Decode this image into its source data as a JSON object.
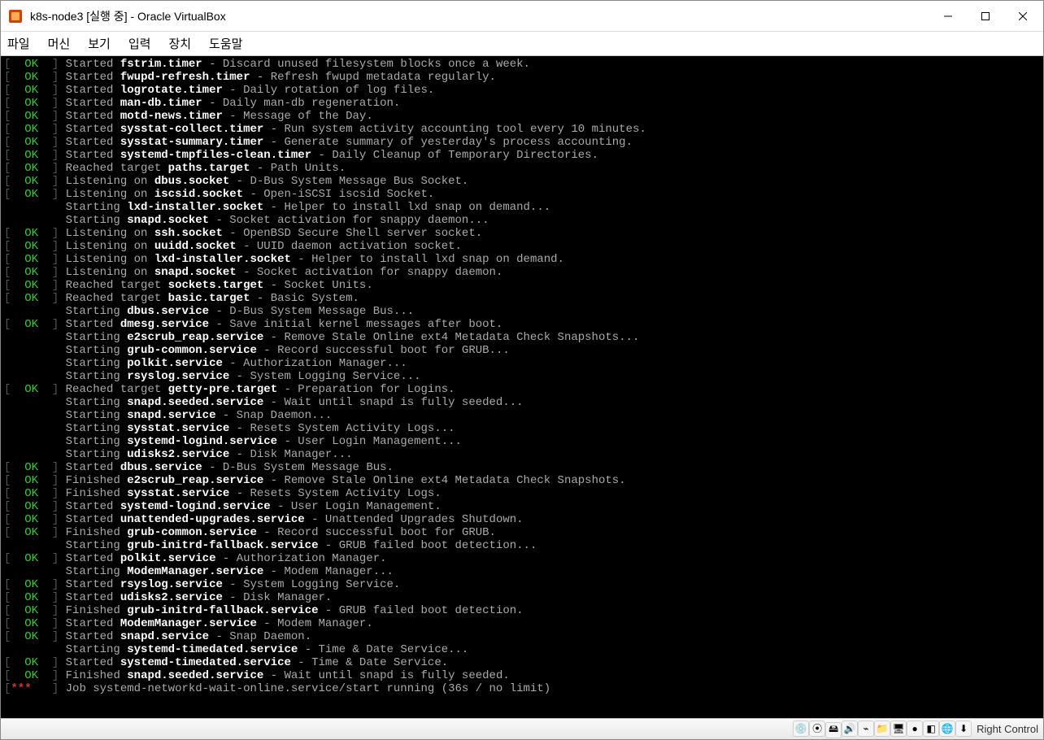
{
  "window": {
    "title": "k8s-node3 [실행 중] - Oracle VirtualBox",
    "key_label": "Right Control"
  },
  "menu": {
    "file": "파일",
    "machine": "머신",
    "view": "보기",
    "input": "입력",
    "device": "장치",
    "help": "도움말"
  },
  "status_icons": [
    "optical-drive-icon",
    "cd-icon",
    "disk-icon",
    "audio-icon",
    "usb-icon",
    "folder-icon",
    "display-icon",
    "record-icon",
    "guest-additions-icon",
    "network-icon",
    "keyboard-capture-icon"
  ],
  "logs": [
    {
      "status": "OK",
      "action": "Started",
      "unit": "fstrim.timer",
      "desc": "Discard unused filesystem blocks once a week."
    },
    {
      "status": "OK",
      "action": "Started",
      "unit": "fwupd-refresh.timer",
      "desc": "Refresh fwupd metadata regularly."
    },
    {
      "status": "OK",
      "action": "Started",
      "unit": "logrotate.timer",
      "desc": "Daily rotation of log files."
    },
    {
      "status": "OK",
      "action": "Started",
      "unit": "man-db.timer",
      "desc": "Daily man-db regeneration."
    },
    {
      "status": "OK",
      "action": "Started",
      "unit": "motd-news.timer",
      "desc": "Message of the Day."
    },
    {
      "status": "OK",
      "action": "Started",
      "unit": "sysstat-collect.timer",
      "desc": "Run system activity accounting tool every 10 minutes."
    },
    {
      "status": "OK",
      "action": "Started",
      "unit": "sysstat-summary.timer",
      "desc": "Generate summary of yesterday's process accounting."
    },
    {
      "status": "OK",
      "action": "Started",
      "unit": "systemd-tmpfiles-clean.timer",
      "desc": "Daily Cleanup of Temporary Directories."
    },
    {
      "status": "OK",
      "action": "Reached target",
      "unit": "paths.target",
      "desc": "Path Units."
    },
    {
      "status": "OK",
      "action": "Listening on",
      "unit": "dbus.socket",
      "desc": "D-Bus System Message Bus Socket."
    },
    {
      "status": "OK",
      "action": "Listening on",
      "unit": "iscsid.socket",
      "desc": "Open-iSCSI iscsid Socket."
    },
    {
      "status": "",
      "action": "Starting",
      "unit": "lxd-installer.socket",
      "desc": "Helper to install lxd snap on demand..."
    },
    {
      "status": "",
      "action": "Starting",
      "unit": "snapd.socket",
      "desc": "Socket activation for snappy daemon..."
    },
    {
      "status": "OK",
      "action": "Listening on",
      "unit": "ssh.socket",
      "desc": "OpenBSD Secure Shell server socket."
    },
    {
      "status": "OK",
      "action": "Listening on",
      "unit": "uuidd.socket",
      "desc": "UUID daemon activation socket."
    },
    {
      "status": "OK",
      "action": "Listening on",
      "unit": "lxd-installer.socket",
      "desc": "Helper to install lxd snap on demand."
    },
    {
      "status": "OK",
      "action": "Listening on",
      "unit": "snapd.socket",
      "desc": "Socket activation for snappy daemon."
    },
    {
      "status": "OK",
      "action": "Reached target",
      "unit": "sockets.target",
      "desc": "Socket Units."
    },
    {
      "status": "OK",
      "action": "Reached target",
      "unit": "basic.target",
      "desc": "Basic System."
    },
    {
      "status": "",
      "action": "Starting",
      "unit": "dbus.service",
      "desc": "D-Bus System Message Bus..."
    },
    {
      "status": "OK",
      "action": "Started",
      "unit": "dmesg.service",
      "desc": "Save initial kernel messages after boot."
    },
    {
      "status": "",
      "action": "Starting",
      "unit": "e2scrub_reap.service",
      "desc": "Remove Stale Online ext4 Metadata Check Snapshots..."
    },
    {
      "status": "",
      "action": "Starting",
      "unit": "grub-common.service",
      "desc": "Record successful boot for GRUB..."
    },
    {
      "status": "",
      "action": "Starting",
      "unit": "polkit.service",
      "desc": "Authorization Manager..."
    },
    {
      "status": "",
      "action": "Starting",
      "unit": "rsyslog.service",
      "desc": "System Logging Service..."
    },
    {
      "status": "OK",
      "action": "Reached target",
      "unit": "getty-pre.target",
      "desc": "Preparation for Logins."
    },
    {
      "status": "",
      "action": "Starting",
      "unit": "snapd.seeded.service",
      "desc": "Wait until snapd is fully seeded..."
    },
    {
      "status": "",
      "action": "Starting",
      "unit": "snapd.service",
      "desc": "Snap Daemon..."
    },
    {
      "status": "",
      "action": "Starting",
      "unit": "sysstat.service",
      "desc": "Resets System Activity Logs..."
    },
    {
      "status": "",
      "action": "Starting",
      "unit": "systemd-logind.service",
      "desc": "User Login Management..."
    },
    {
      "status": "",
      "action": "Starting",
      "unit": "udisks2.service",
      "desc": "Disk Manager..."
    },
    {
      "status": "OK",
      "action": "Started",
      "unit": "dbus.service",
      "desc": "D-Bus System Message Bus."
    },
    {
      "status": "OK",
      "action": "Finished",
      "unit": "e2scrub_reap.service",
      "desc": "Remove Stale Online ext4 Metadata Check Snapshots."
    },
    {
      "status": "OK",
      "action": "Finished",
      "unit": "sysstat.service",
      "desc": "Resets System Activity Logs."
    },
    {
      "status": "OK",
      "action": "Started",
      "unit": "systemd-logind.service",
      "desc": "User Login Management."
    },
    {
      "status": "OK",
      "action": "Started",
      "unit": "unattended-upgrades.service",
      "desc": "Unattended Upgrades Shutdown."
    },
    {
      "status": "OK",
      "action": "Finished",
      "unit": "grub-common.service",
      "desc": "Record successful boot for GRUB."
    },
    {
      "status": "",
      "action": "Starting",
      "unit": "grub-initrd-fallback.service",
      "desc": "GRUB failed boot detection..."
    },
    {
      "status": "OK",
      "action": "Started",
      "unit": "polkit.service",
      "desc": "Authorization Manager."
    },
    {
      "status": "",
      "action": "Starting",
      "unit": "ModemManager.service",
      "desc": "Modem Manager..."
    },
    {
      "status": "OK",
      "action": "Started",
      "unit": "rsyslog.service",
      "desc": "System Logging Service."
    },
    {
      "status": "OK",
      "action": "Started",
      "unit": "udisks2.service",
      "desc": "Disk Manager."
    },
    {
      "status": "OK",
      "action": "Finished",
      "unit": "grub-initrd-fallback.service",
      "desc": "GRUB failed boot detection."
    },
    {
      "status": "OK",
      "action": "Started",
      "unit": "ModemManager.service",
      "desc": "Modem Manager."
    },
    {
      "status": "OK",
      "action": "Started",
      "unit": "snapd.service",
      "desc": "Snap Daemon."
    },
    {
      "status": "",
      "action": "Starting",
      "unit": "systemd-timedated.service",
      "desc": "Time & Date Service..."
    },
    {
      "status": "OK",
      "action": "Started",
      "unit": "systemd-timedated.service",
      "desc": "Time & Date Service."
    },
    {
      "status": "OK",
      "action": "Finished",
      "unit": "snapd.seeded.service",
      "desc": "Wait until snapd is fully seeded."
    },
    {
      "status": "***",
      "action": "",
      "unit": "",
      "desc": "Job systemd-networkd-wait-online.service/start running (36s / no limit)"
    }
  ]
}
